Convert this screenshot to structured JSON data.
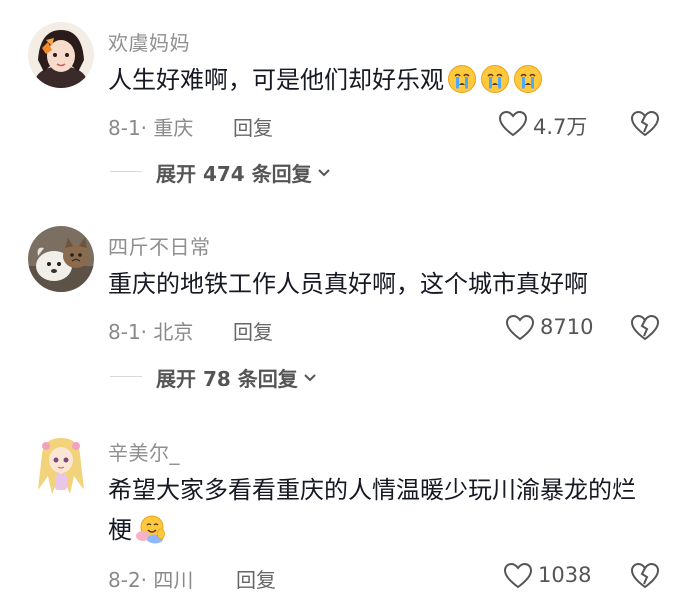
{
  "comments": [
    {
      "username": "欢虞妈妈",
      "text": "人生好难啊，可是他们却好乐观",
      "emoji_icon": "crying-face-icon",
      "emoji_count": 3,
      "date": "8-1·",
      "location": "重庆",
      "reply_label": "回复",
      "likes": "4.7万",
      "expand_label": "展开 474 条回复"
    },
    {
      "username": "四斤不日常",
      "text": "重庆的地铁工作人员真好啊，这个城市真好啊",
      "date": "8-1·",
      "location": "北京",
      "reply_label": "回复",
      "likes": "8710",
      "expand_label": "展开 78 条回复"
    },
    {
      "username": "辛美尔_",
      "text": "希望大家多看看重庆的人情温暖少玩川渝暴龙的烂梗",
      "emoji_icon": "hugging-face-icon",
      "date": "8-2·",
      "location": "四川",
      "reply_label": "回复",
      "likes": "1038"
    }
  ],
  "colors": {
    "text": "#161823",
    "secondary": "#8a8a8a",
    "emoji_yellow": "#ffc83d",
    "tear_blue": "#4aa8ff"
  }
}
